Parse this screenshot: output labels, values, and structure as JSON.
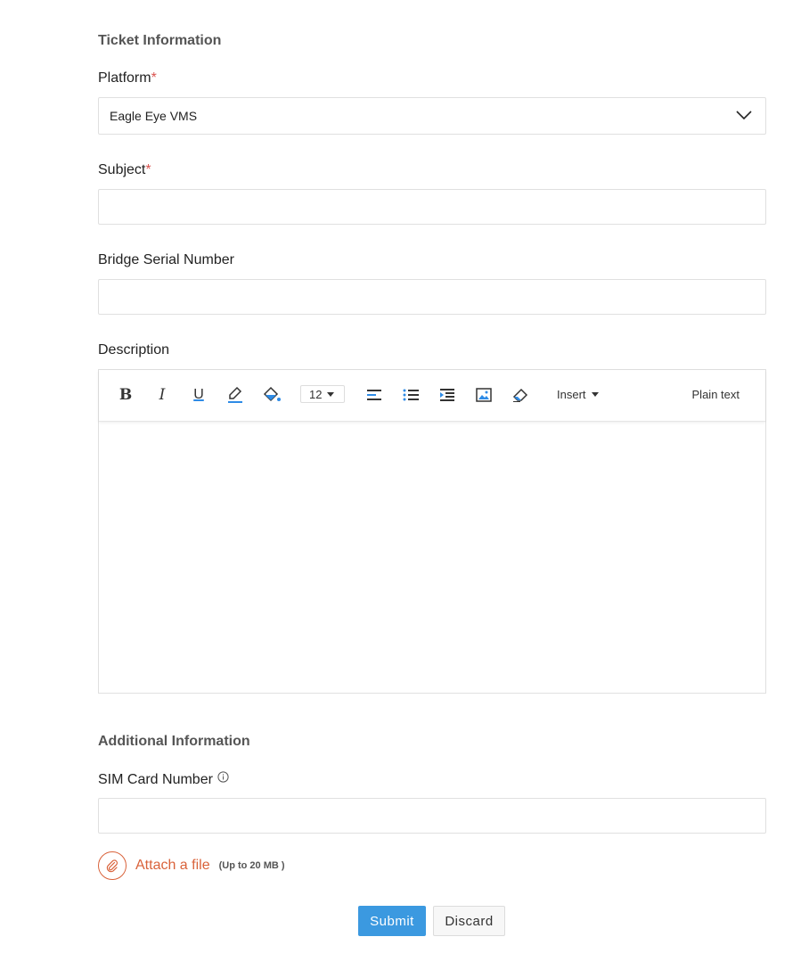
{
  "ticket_section": {
    "title": "Ticket Information"
  },
  "platform": {
    "label": "Platform",
    "required_mark": "*",
    "selected": "Eagle Eye VMS"
  },
  "subject": {
    "label": "Subject",
    "required_mark": "*",
    "value": ""
  },
  "bridge_serial": {
    "label": "Bridge Serial Number",
    "value": ""
  },
  "description": {
    "label": "Description",
    "toolbar": {
      "bold": "B",
      "italic": "I",
      "underline": "U",
      "font_size": "12",
      "insert_label": "Insert",
      "plain_text_label": "Plain text"
    },
    "value": ""
  },
  "additional_section": {
    "title": "Additional Information"
  },
  "sim_card": {
    "label": "SIM Card Number",
    "value": ""
  },
  "attach": {
    "label": "Attach a file",
    "note": "(Up to 20 MB )"
  },
  "actions": {
    "submit": "Submit",
    "discard": "Discard"
  },
  "colors": {
    "accent": "#3b99e0",
    "attach": "#d9623a",
    "required": "#d9534f"
  }
}
